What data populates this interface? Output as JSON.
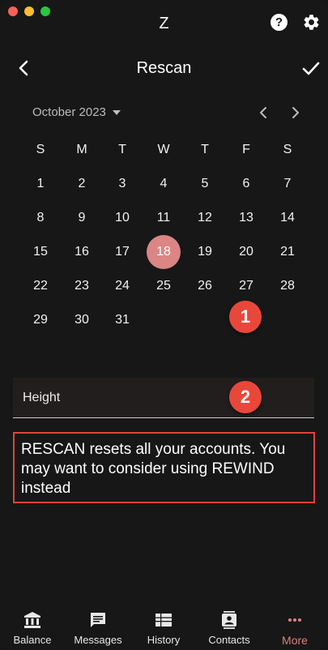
{
  "window": {
    "app_letter": "Z"
  },
  "header": {
    "title": "Rescan"
  },
  "calendar": {
    "month_label": "October 2023",
    "weekdays": [
      "S",
      "M",
      "T",
      "W",
      "T",
      "F",
      "S"
    ],
    "days": [
      "1",
      "2",
      "3",
      "4",
      "5",
      "6",
      "7",
      "8",
      "9",
      "10",
      "11",
      "12",
      "13",
      "14",
      "15",
      "16",
      "17",
      "18",
      "19",
      "20",
      "21",
      "22",
      "23",
      "24",
      "25",
      "26",
      "27",
      "28",
      "29",
      "30",
      "31"
    ],
    "selected_day": "18"
  },
  "markers": [
    "1",
    "2"
  ],
  "height_field": {
    "label": "Height"
  },
  "warning": {
    "text": "RESCAN resets all your accounts. You may want to consider using REWIND instead"
  },
  "bottom_nav": [
    {
      "label": "Balance",
      "icon": "bank-icon"
    },
    {
      "label": "Messages",
      "icon": "message-icon"
    },
    {
      "label": "History",
      "icon": "history-icon"
    },
    {
      "label": "Contacts",
      "icon": "contacts-icon"
    },
    {
      "label": "More",
      "icon": "more-icon",
      "active": true
    }
  ],
  "colors": {
    "accent": "#e07f7f",
    "selected_day": "#db8585",
    "marker": "#e8483a",
    "warning_border": "#e0453a",
    "background": "#171717"
  }
}
